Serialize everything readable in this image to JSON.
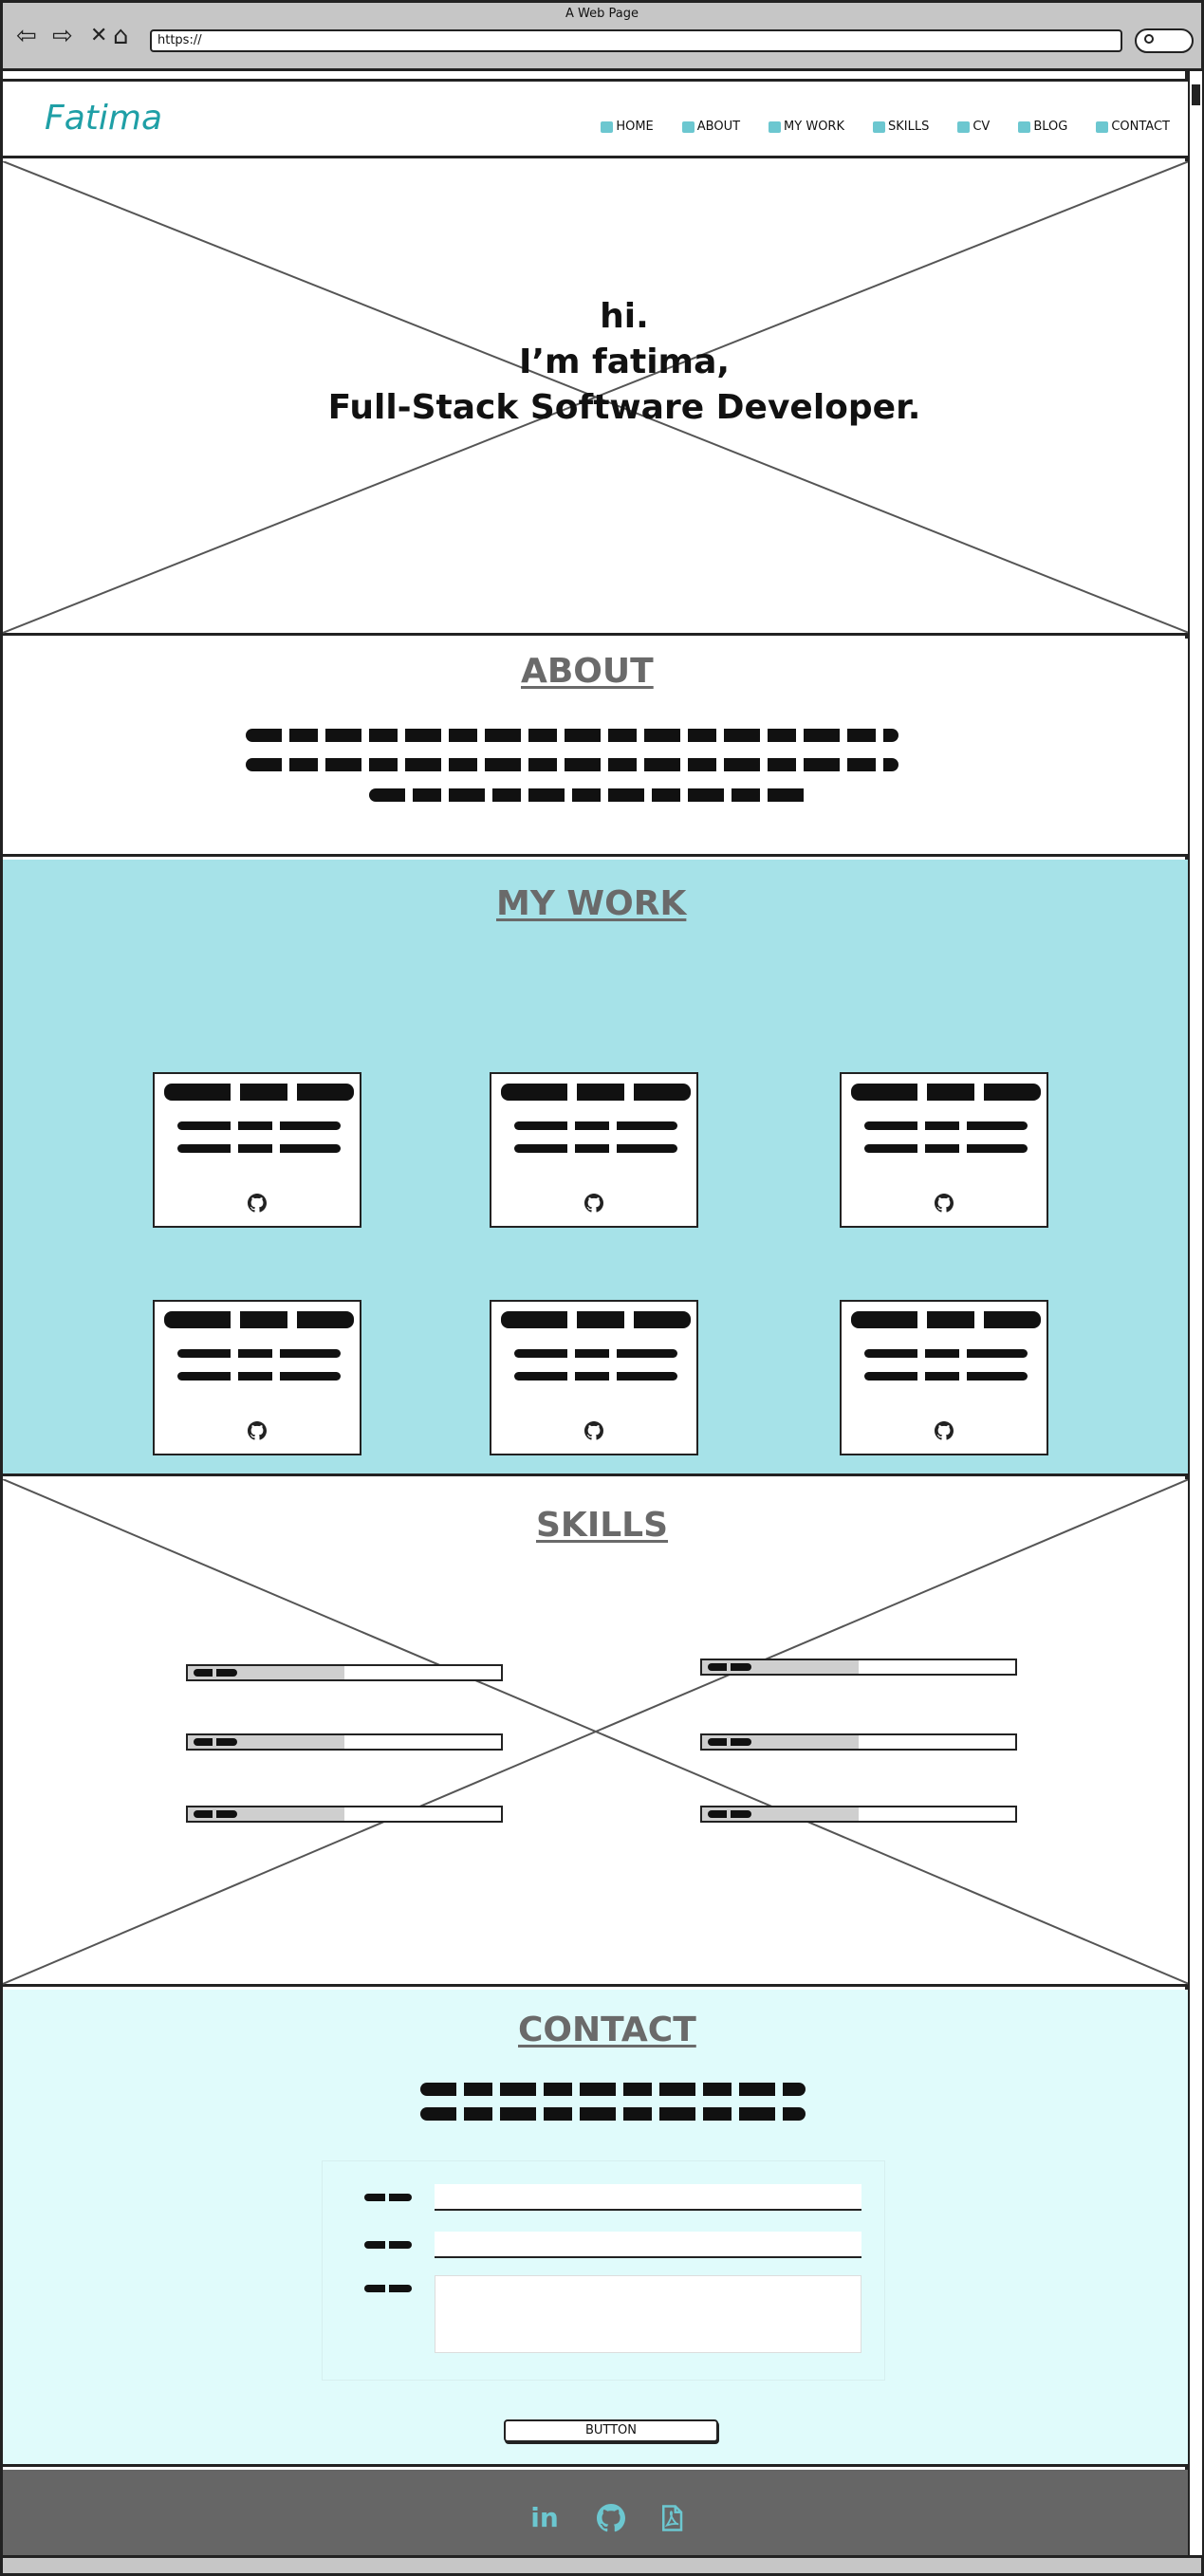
{
  "browser": {
    "window_title": "A Web Page",
    "url": "https://"
  },
  "header": {
    "logo": "Fatima",
    "nav": [
      {
        "label": "HOME",
        "icon": "home-icon"
      },
      {
        "label": "ABOUT",
        "icon": "user-icon"
      },
      {
        "label": "MY WORK",
        "icon": "monitor-icon"
      },
      {
        "label": "SKILLS",
        "icon": "database-icon"
      },
      {
        "label": "CV",
        "icon": "document-icon"
      },
      {
        "label": "BLOG",
        "icon": "pencil-icon"
      },
      {
        "label": "CONTACT",
        "icon": "envelope-icon"
      }
    ]
  },
  "hero": {
    "line1": "hi.",
    "line2": "I’m fatima,",
    "line3": "Full-Stack Software Developer."
  },
  "about": {
    "heading": "ABOUT"
  },
  "work": {
    "heading": "MY WORK",
    "cards": [
      {
        "icon": "github-icon"
      },
      {
        "icon": "github-icon"
      },
      {
        "icon": "github-icon"
      },
      {
        "icon": "github-icon"
      },
      {
        "icon": "github-icon"
      },
      {
        "icon": "github-icon"
      }
    ]
  },
  "skills": {
    "heading": "SKILLS",
    "levels": [
      0.5,
      0.5,
      0.5,
      0.5,
      0.5,
      0.5
    ]
  },
  "contact": {
    "heading": "CONTACT",
    "button_label": "BUTTON"
  },
  "footer": {
    "icons": [
      "linkedin-icon",
      "github-icon",
      "pdf-icon"
    ],
    "icon_color": "#6cc7d0"
  },
  "colors": {
    "accent": "#1f9fa6",
    "work_bg": "#a6e2e8",
    "contact_bg": "#e0fbfb",
    "footer_bg": "#666666"
  }
}
